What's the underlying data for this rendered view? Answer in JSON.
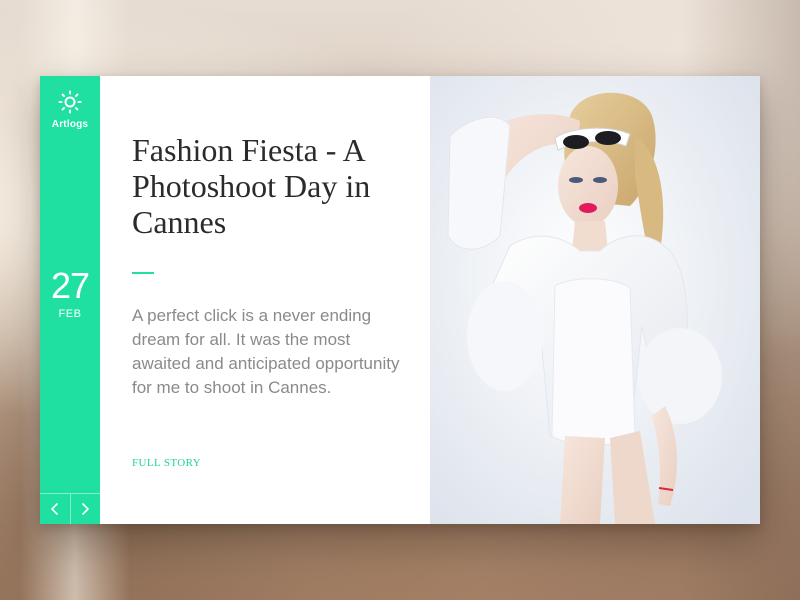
{
  "brand": {
    "name": "Artlogs",
    "logo_icon": "sun-icon"
  },
  "date": {
    "day": "27",
    "month": "FEB"
  },
  "article": {
    "title": "Fashion Fiesta - A Photoshoot Day in Cannes",
    "excerpt": "A perfect click is a never ending dream for all. It was the most awaited and anticipated opportunity for me to shoot in Cannes.",
    "cta_label": "FULL STORY"
  },
  "nav": {
    "prev_icon": "chevron-left-icon",
    "next_icon": "chevron-right-icon"
  },
  "colors": {
    "accent": "#1fe0a0",
    "title": "#2b2b2b",
    "body": "#8a8a8a",
    "card": "#ffffff"
  }
}
